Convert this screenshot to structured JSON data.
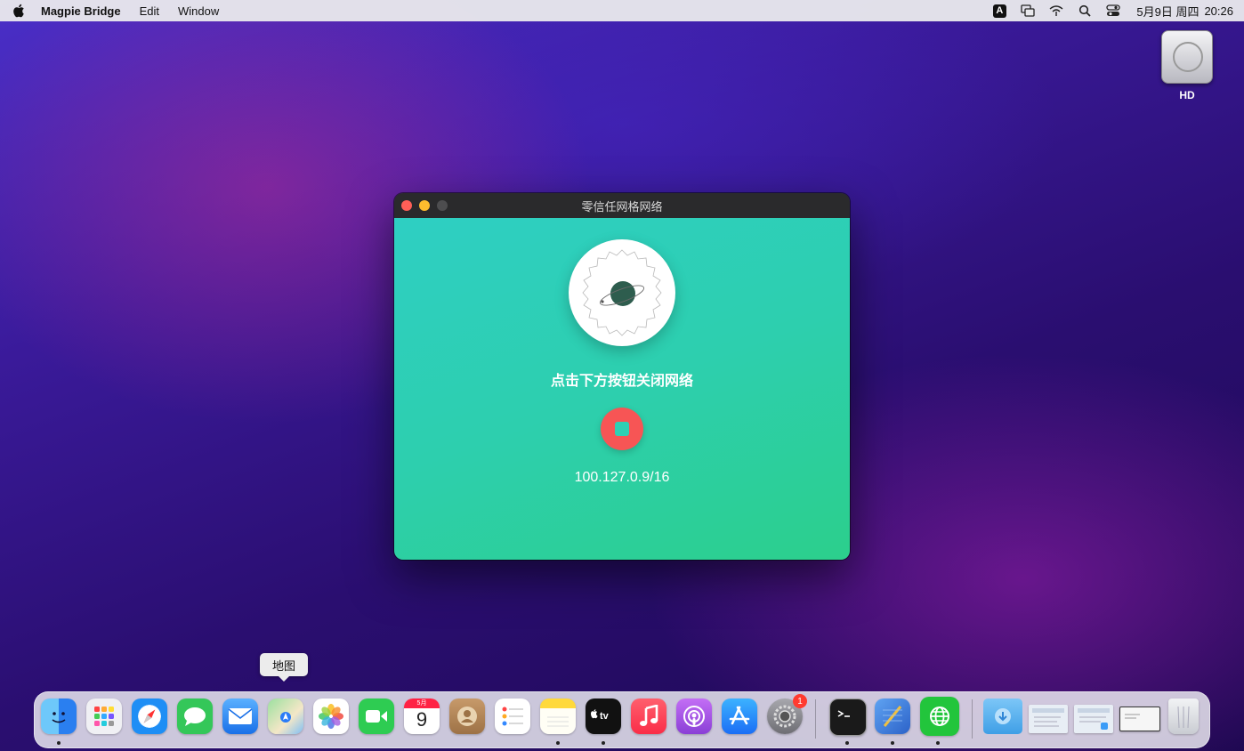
{
  "menubar": {
    "app_name": "Magpie Bridge",
    "items": [
      "Edit",
      "Window"
    ],
    "status_icons": [
      "input-source-icon",
      "display-icon",
      "wifi-icon",
      "search-icon",
      "control-center-icon"
    ],
    "input_source_letter": "A",
    "date": "5月9日 周四",
    "time": "20:26"
  },
  "desktop": {
    "drive_label": "HD"
  },
  "window": {
    "title": "零信任网格网络",
    "headline": "点击下方按钮关闭网络",
    "ip_address": "100.127.0.9/16",
    "colors": {
      "gradient_start": "#2ecfc3",
      "gradient_end": "#2ccf8c",
      "stop_button": "#f75555"
    }
  },
  "tooltip": {
    "label": "地图"
  },
  "dock": {
    "calendar": {
      "month": "5月",
      "day": "9"
    },
    "system_prefs_badge": "1",
    "apps": [
      {
        "name": "finder-icon",
        "color": "#3b9cf7",
        "running": true
      },
      {
        "name": "launchpad-icon",
        "color": "#f0f0f4",
        "running": false
      },
      {
        "name": "safari-icon",
        "color": "#1e8ef5",
        "running": false
      },
      {
        "name": "messages-icon",
        "color": "#34c759",
        "running": false
      },
      {
        "name": "mail-icon",
        "color": "#2a8cf6",
        "running": false
      },
      {
        "name": "maps-icon",
        "color": "#6fd08c",
        "running": false
      },
      {
        "name": "photos-icon",
        "color": "#ffffff",
        "running": false
      },
      {
        "name": "facetime-icon",
        "color": "#2ecc52",
        "running": false
      },
      {
        "name": "calendar-icon",
        "color": "#ffffff",
        "running": false
      },
      {
        "name": "contacts-icon",
        "color": "#b98a5a",
        "running": false
      },
      {
        "name": "reminders-icon",
        "color": "#ffffff",
        "running": false
      },
      {
        "name": "notes-icon",
        "color": "#fff5c0",
        "running": true
      },
      {
        "name": "apple-tv-icon",
        "color": "#111111",
        "running": true
      },
      {
        "name": "music-icon",
        "color": "#fa2d48",
        "running": false
      },
      {
        "name": "podcasts-icon",
        "color": "#9b4ee0",
        "running": false
      },
      {
        "name": "app-store-icon",
        "color": "#1b8cf5",
        "running": false
      },
      {
        "name": "system-preferences-icon",
        "color": "#8e8e93",
        "running": false
      },
      {
        "name": "terminal-icon",
        "color": "#1a1a1a",
        "running": true
      },
      {
        "name": "xcode-icon",
        "color": "#3d7de0",
        "running": true
      },
      {
        "name": "magpie-bridge-icon",
        "color": "#22c53c",
        "running": true
      },
      {
        "name": "downloads-folder-icon",
        "color": "#5fb6f2",
        "running": false
      },
      {
        "name": "window-thumbnail-1-icon",
        "color": "#e8eef5",
        "running": false
      },
      {
        "name": "window-thumbnail-2-icon",
        "color": "#e8eef5",
        "running": false
      },
      {
        "name": "window-thumbnail-3-icon",
        "color": "#f6f6f6",
        "running": false
      },
      {
        "name": "trash-icon",
        "color": "#d8dadf",
        "running": false
      }
    ]
  }
}
